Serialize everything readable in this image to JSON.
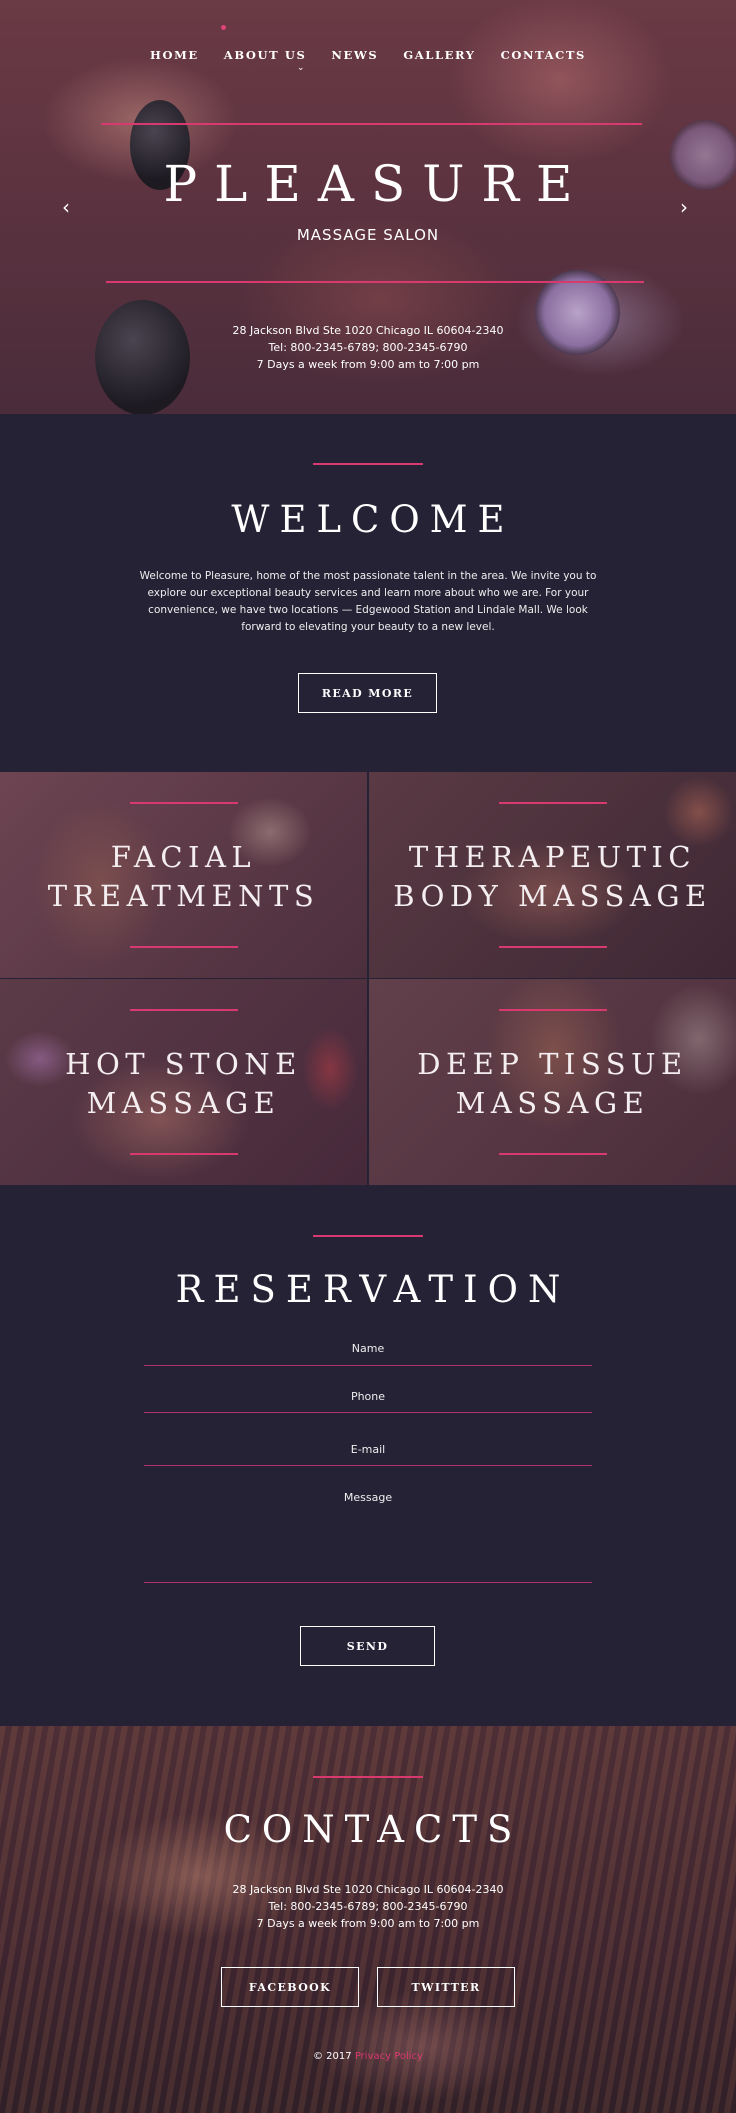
{
  "nav": {
    "items": [
      "HOME",
      "ABOUT US",
      "NEWS",
      "GALLERY",
      "CONTACTS"
    ]
  },
  "hero": {
    "title": "PLEASURE",
    "subtitle": "MASSAGE SALON",
    "address": "28 Jackson Blvd Ste 1020 Chicago IL 60604-2340",
    "phone": "Tel: 800-2345-6789; 800-2345-6790",
    "hours": "7 Days a week from 9:00 am to 7:00 pm",
    "prev_arrow": "‹",
    "next_arrow": "›"
  },
  "welcome": {
    "title": "WELCOME",
    "text": "Welcome to Pleasure, home of the most passionate talent in the area. We invite you to explore our exceptional beauty services and learn more about who we are. For your convenience, we have two locations — Edgewood Station and Lindale Mall. We look forward to elevating your beauty to a new level.",
    "button": "READ MORE"
  },
  "services": [
    {
      "line1": "FACIAL",
      "line2": "TREATMENTS"
    },
    {
      "line1": "THERAPEUTIC",
      "line2": "BODY MASSAGE"
    },
    {
      "line1": "HOT STONE",
      "line2": "MASSAGE"
    },
    {
      "line1": "DEEP TISSUE",
      "line2": "MASSAGE"
    }
  ],
  "reservation": {
    "title": "RESERVATION",
    "fields": [
      "Name",
      "Phone",
      "E-mail",
      "Message"
    ],
    "button": "SEND"
  },
  "contacts": {
    "title": "CONTACTS",
    "address": "28 Jackson Blvd Ste 1020 Chicago IL 60604-2340",
    "phone": "Tel: 800-2345-6789; 800-2345-6790",
    "hours": "7 Days a week from 9:00 am to 7:00 pm",
    "facebook": "FACEBOOK",
    "twitter": "TWITTER",
    "copyright": "© 2017",
    "privacy": "Privacy Policy"
  },
  "colors": {
    "accent": "#d8396f",
    "background": "#252235"
  }
}
